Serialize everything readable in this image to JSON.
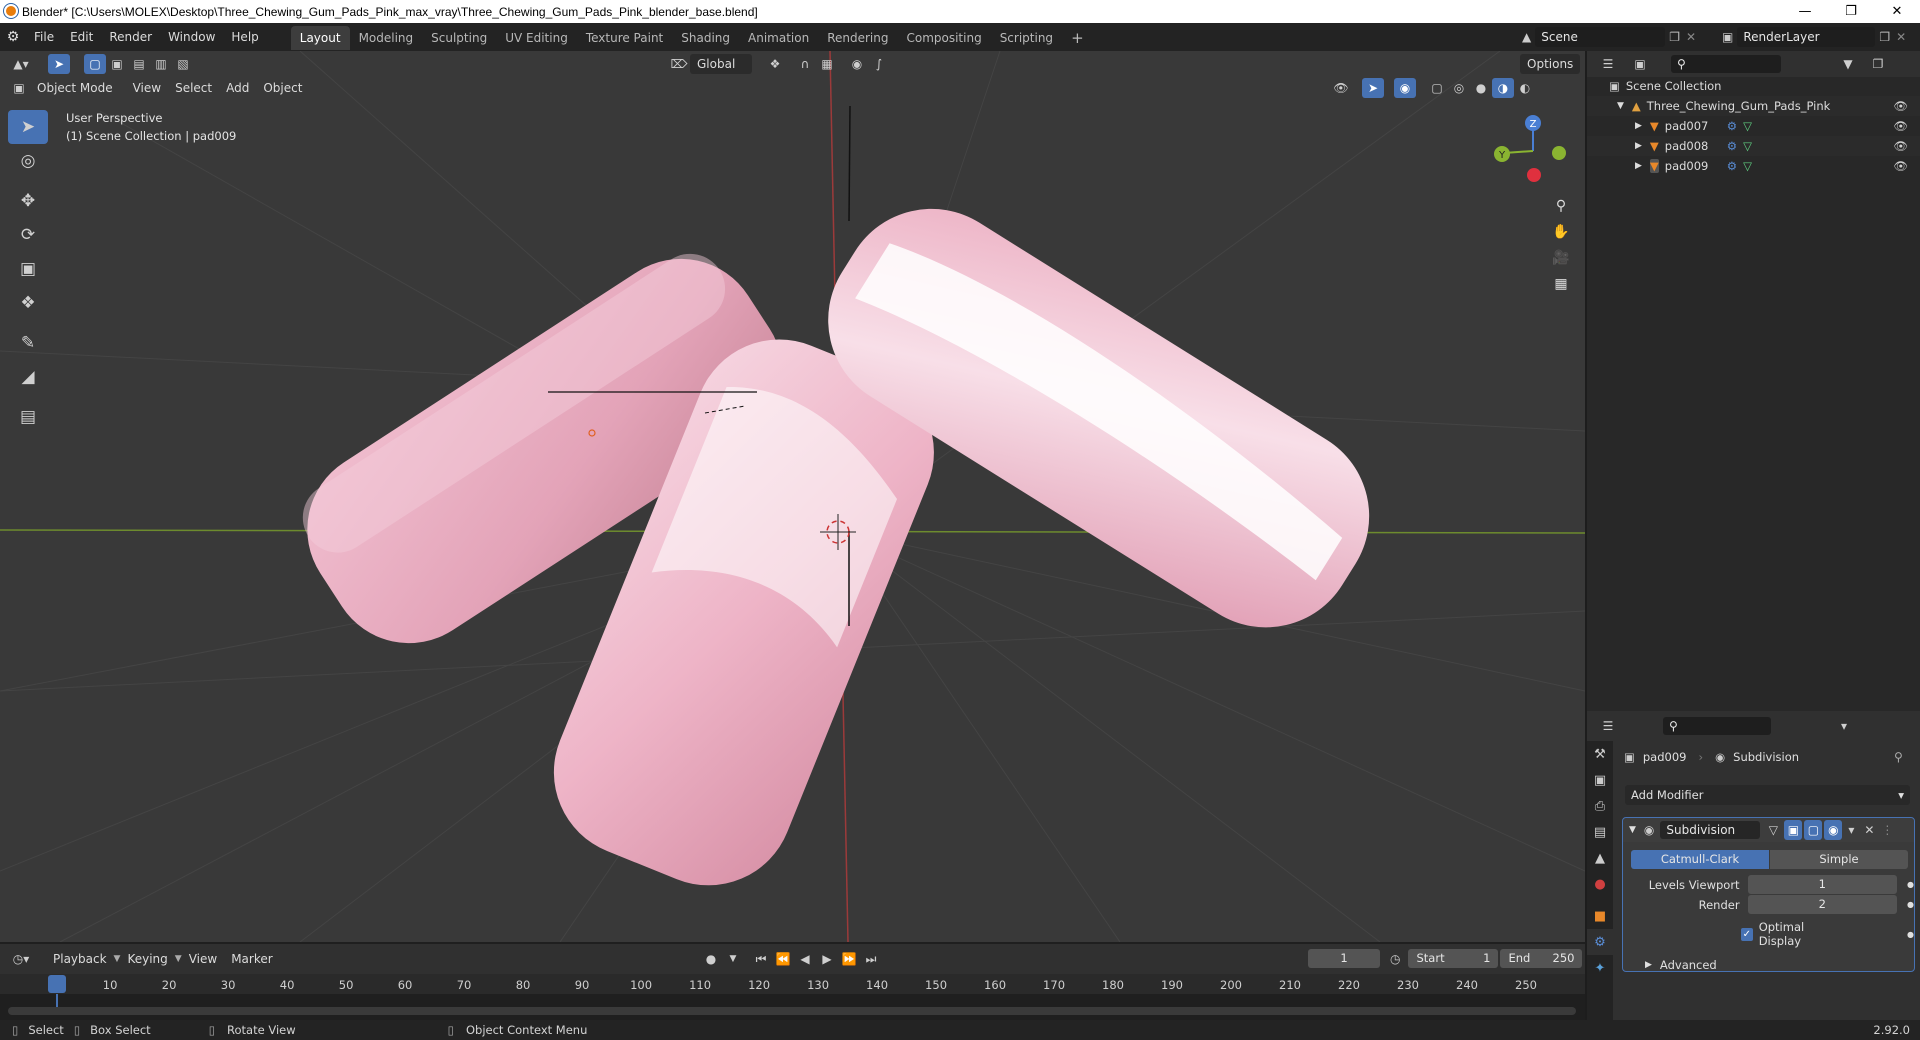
{
  "window": {
    "title": "Blender* [C:\\Users\\MOLEX\\Desktop\\Three_Chewing_Gum_Pads_Pink_max_vray\\Three_Chewing_Gum_Pads_Pink_blender_base.blend]",
    "controls": [
      "minimize-icon",
      "restore-icon",
      "close-icon"
    ]
  },
  "menu": [
    "File",
    "Edit",
    "Render",
    "Window",
    "Help"
  ],
  "workspaces": [
    "Layout",
    "Modeling",
    "Sculpting",
    "UV Editing",
    "Texture Paint",
    "Shading",
    "Animation",
    "Rendering",
    "Compositing",
    "Scripting"
  ],
  "active_workspace": "Layout",
  "scene": "Scene",
  "render_layer": "RenderLayer",
  "viewport": {
    "transform_orientation": "Global",
    "options_label": "Options",
    "mode": "Object Mode",
    "header_menus": [
      "View",
      "Select",
      "Add",
      "Object"
    ],
    "overlay_line1": "User Perspective",
    "overlay_line2": "(1) Scene Collection | pad009",
    "gizmo_axes": {
      "z": "Z",
      "y": "Y"
    },
    "colors": {
      "background": "#393939",
      "gum": "#e8a6bc",
      "x_axis": "#9c3a3a",
      "y_axis": "#6d8b2e",
      "accent": "#4772b3"
    }
  },
  "outliner": {
    "root": "Scene Collection",
    "collection": "Three_Chewing_Gum_Pads_Pink",
    "objects": [
      "pad007",
      "pad008",
      "pad009"
    ]
  },
  "properties": {
    "object": "pad009",
    "modifier_context": "Subdivision",
    "add_modifier": "Add Modifier",
    "modifier_name": "Subdivision",
    "algorithms": [
      "Catmull-Clark",
      "Simple"
    ],
    "active_algorithm": "Catmull-Clark",
    "levels_viewport_label": "Levels Viewport",
    "levels_viewport": "1",
    "render_label": "Render",
    "render_levels": "2",
    "optimal_display_label": "Optimal Display",
    "optimal_display": true,
    "advanced_label": "Advanced"
  },
  "timeline": {
    "menus": [
      "Playback",
      "Keying",
      "View",
      "Marker"
    ],
    "current_frame": "1",
    "start_label": "Start",
    "start": "1",
    "end_label": "End",
    "end": "250",
    "ticks": [
      "1",
      "10",
      "20",
      "30",
      "40",
      "50",
      "60",
      "70",
      "80",
      "90",
      "100",
      "110",
      "120",
      "130",
      "140",
      "150",
      "160",
      "170",
      "180",
      "190",
      "200",
      "210",
      "220",
      "230",
      "240",
      "250"
    ]
  },
  "statusbar": {
    "select": "Select",
    "box_select": "Box Select",
    "rotate_view": "Rotate View",
    "context_menu": "Object Context Menu",
    "version": "2.92.0"
  }
}
